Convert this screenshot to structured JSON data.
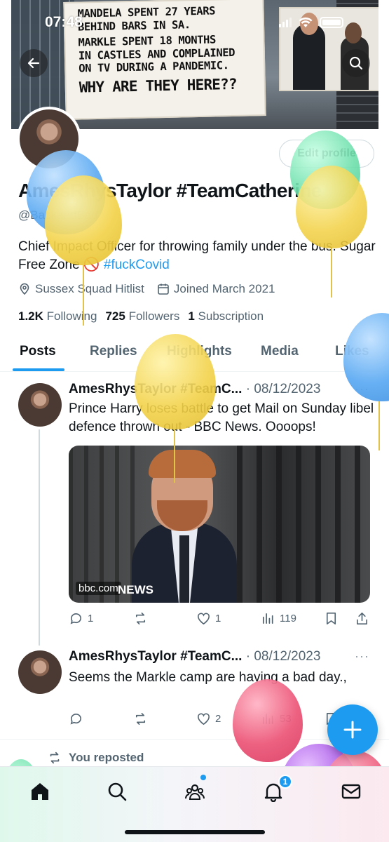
{
  "status_bar": {
    "time": "07:48"
  },
  "banner": {
    "sign_lines": [
      "Mandela spent 27 years",
      "behind bars in SA.",
      "Markle spent 18 months",
      "in castles and complained",
      "on TV during a pandemic.",
      "Why are they here??"
    ]
  },
  "header": {
    "back_icon": "back-arrow-icon",
    "search_icon": "search-icon"
  },
  "profile": {
    "edit_label": "Edit profile",
    "display_name": "AmesRhysTaylor #TeamCatherine",
    "handle": "@BackandBad",
    "bio_text": "Chief Impact Officer for throwing family under the bus. Sugar Free Zone 🚫 ",
    "bio_hashtag": "#fuckCovid",
    "location": "Sussex Squad Hitlist",
    "joined": "Joined March 2021",
    "following_count": "1.2K",
    "following_label": "Following",
    "followers_count": "725",
    "followers_label": "Followers",
    "subscription_count": "1",
    "subscription_label": "Subscription"
  },
  "tabs": [
    "Posts",
    "Replies",
    "Highlights",
    "Media",
    "Likes"
  ],
  "tweets": [
    {
      "name": "AmesRhysTaylor #TeamC...",
      "date": "· 08/12/2023",
      "more": "···",
      "text": "Prince Harry loses battle to get Mail on Sunday libel defence thrown out - BBC News. Oooops!",
      "media_source": "bbc.com",
      "media_brand": "NEWS",
      "replies": "1",
      "likes": "1",
      "views": "119"
    },
    {
      "name": "AmesRhysTaylor #TeamC...",
      "date": "· 08/12/2023",
      "more": "···",
      "text": "Seems the Markle camp are having a bad day.,",
      "replies": "",
      "likes": "2",
      "views": "53"
    }
  ],
  "reposted_label": "You reposted",
  "fab_label": "+",
  "bottom_nav": {
    "items": [
      "home-icon",
      "search-icon",
      "communities-icon",
      "notifications-icon",
      "messages-icon"
    ],
    "notification_count": "1"
  },
  "colors": {
    "accent": "#1d9bf0",
    "text": "#0f1419",
    "muted": "#536471"
  }
}
